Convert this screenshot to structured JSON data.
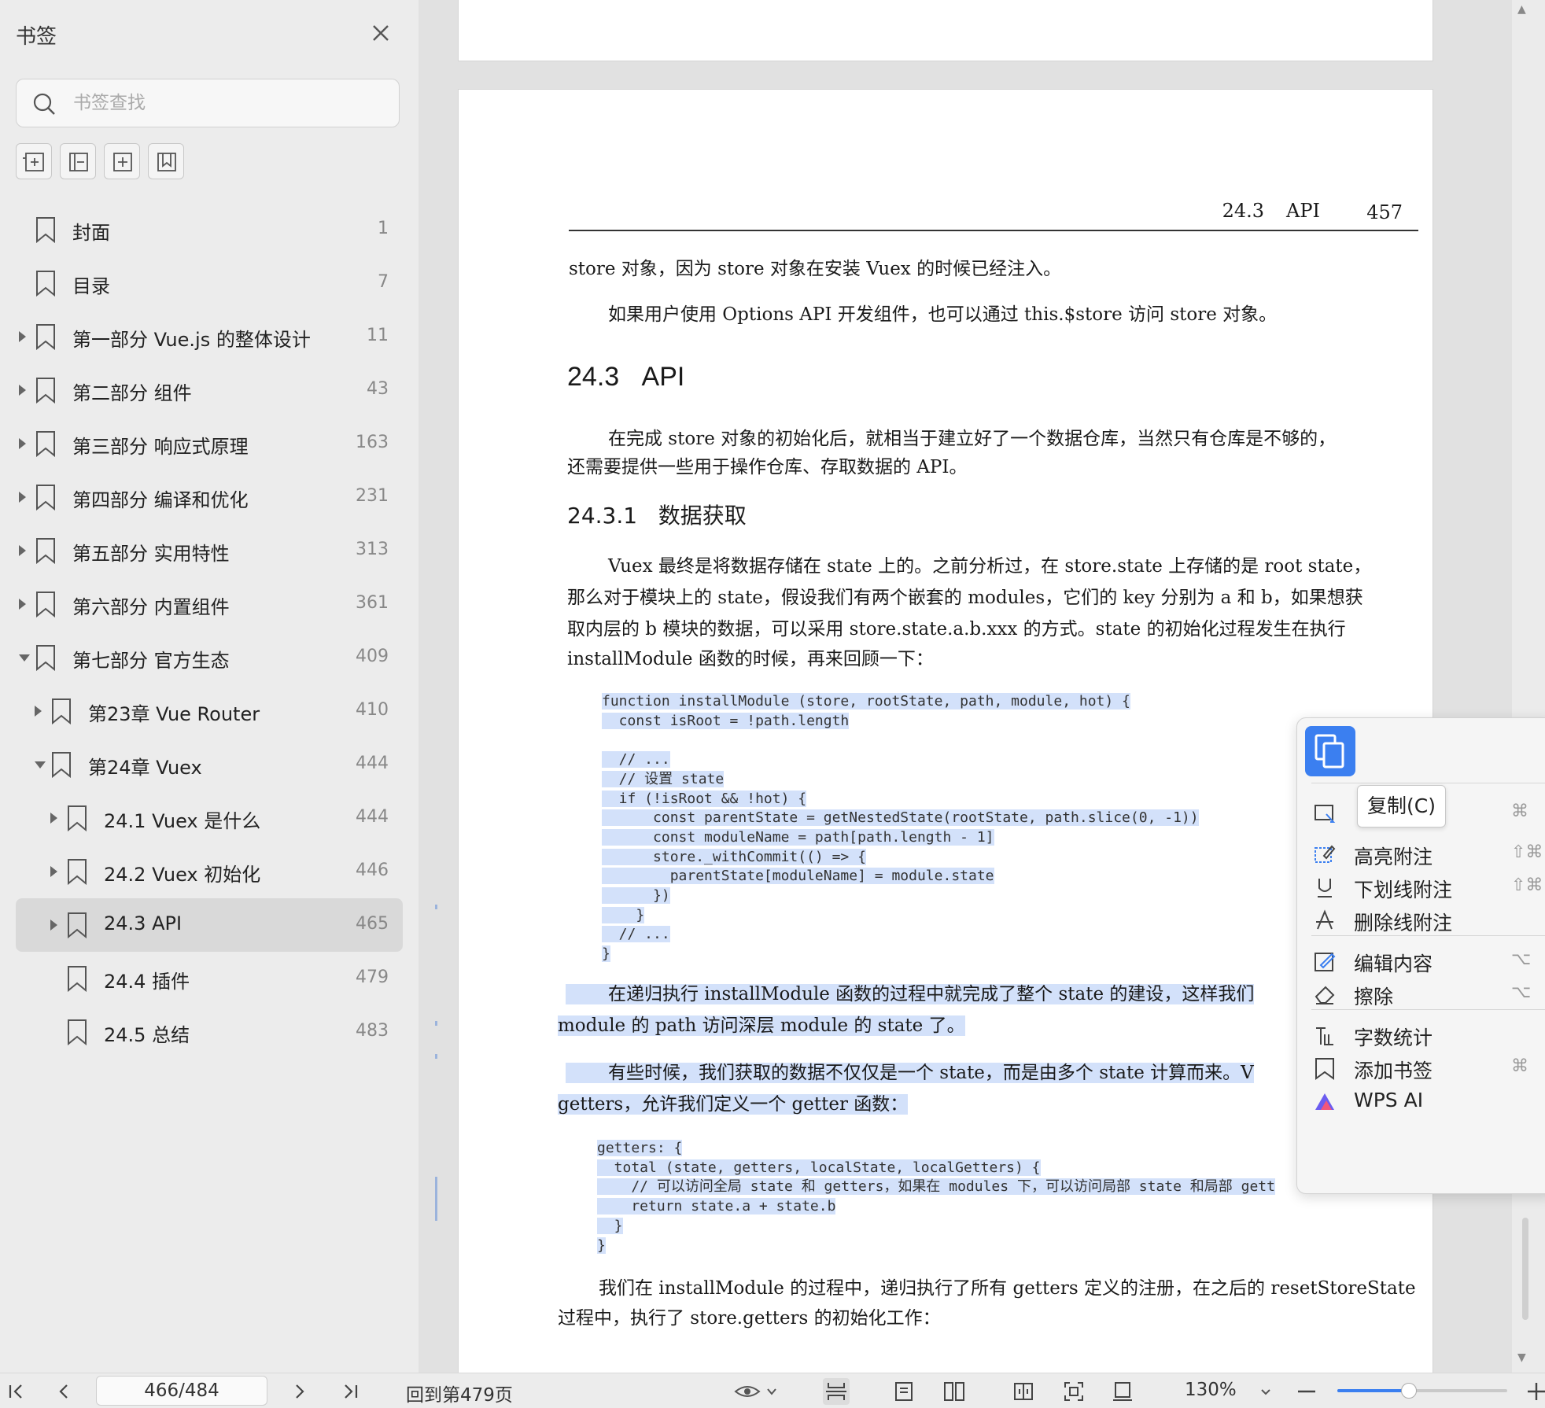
{
  "sidebar": {
    "title": "书签",
    "search_placeholder": "书签查找",
    "tools": [
      "expand-all-icon",
      "collapse-all-icon",
      "add-bookmark-icon",
      "bookmark-icon"
    ],
    "items": [
      {
        "label": "封面",
        "page": "1",
        "level": 0,
        "arrow": "none"
      },
      {
        "label": "目录",
        "page": "7",
        "level": 0,
        "arrow": "none"
      },
      {
        "label": "第一部分 Vue.js 的整体设计",
        "page": "11",
        "level": 0,
        "arrow": "collapsed"
      },
      {
        "label": "第二部分 组件",
        "page": "43",
        "level": 0,
        "arrow": "collapsed"
      },
      {
        "label": "第三部分 响应式原理",
        "page": "163",
        "level": 0,
        "arrow": "collapsed"
      },
      {
        "label": "第四部分 编译和优化",
        "page": "231",
        "level": 0,
        "arrow": "collapsed"
      },
      {
        "label": "第五部分 实用特性",
        "page": "313",
        "level": 0,
        "arrow": "collapsed"
      },
      {
        "label": "第六部分 内置组件",
        "page": "361",
        "level": 0,
        "arrow": "collapsed"
      },
      {
        "label": "第七部分 官方生态",
        "page": "409",
        "level": 0,
        "arrow": "expanded"
      },
      {
        "label": "第23章 Vue Router",
        "page": "410",
        "level": 1,
        "arrow": "collapsed"
      },
      {
        "label": "第24章 Vuex",
        "page": "444",
        "level": 1,
        "arrow": "expanded"
      },
      {
        "label": "24.1 Vuex 是什么",
        "page": "444",
        "level": 2,
        "arrow": "collapsed"
      },
      {
        "label": "24.2 Vuex 初始化",
        "page": "446",
        "level": 2,
        "arrow": "collapsed"
      },
      {
        "label": "24.3 API",
        "page": "465",
        "level": 2,
        "arrow": "collapsed",
        "selected": true
      },
      {
        "label": "24.4 插件",
        "page": "479",
        "level": 2,
        "arrow": "none"
      },
      {
        "label": "24.5 总结",
        "page": "483",
        "level": 2,
        "arrow": "none"
      }
    ]
  },
  "document": {
    "running_head": {
      "section": "24.3",
      "title": "API",
      "page": "457"
    },
    "p1": "store 对象，因为 store 对象在安装 Vuex 的时候已经注入。",
    "p2": "如果用户使用 Options API 开发组件，也可以通过 this.$store 访问 store 对象。",
    "h_section_num": "24.3",
    "h_section_title": "API",
    "p3_line1": "在完成 store 对象的初始化后，就相当于建立好了一个数据仓库，当然只有仓库是不够的，",
    "p3_line2": "还需要提供一些用于操作仓库、存取数据的 API。",
    "h_sub_num": "24.3.1",
    "h_sub_title": "数据获取",
    "p4_line1": "Vuex 最终是将数据存储在 state 上的。之前分析过，在 store.state 上存储的是 root state，",
    "p4_line2": "那么对于模块上的 state，假设我们有两个嵌套的 modules，它们的 key 分别为 a 和 b，如果想获",
    "p4_line3": "取内层的 b 模块的数据，可以采用 store.state.a.b.xxx 的方式。state 的初始化过程发生在执行",
    "p4_line4": "installModule 函数的时候，再来回顾一下：",
    "code1": [
      "function installModule (store, rootState, path, module, hot) {",
      "  const isRoot = !path.length",
      "",
      "  // ...",
      "  // 设置 state",
      "  if (!isRoot && !hot) {",
      "      const parentState = getNestedState(rootState, path.slice(0, -1))",
      "      const moduleName = path[path.length - 1]",
      "      store._withCommit(() => {",
      "        parentState[moduleName] = module.state",
      "      })",
      "    }",
      "  // ...",
      "}"
    ],
    "p5_line1": "在递归执行 installModule 函数的过程中就完成了整个 state 的建设，这样我们",
    "p5_line2": "module 的 path 访问深层 module 的 state 了。",
    "p6_line1": "有些时候，我们获取的数据不仅仅是一个 state，而是由多个 state 计算而来。V",
    "p6_line2": "getters，允许我们定义一个 getter 函数：",
    "code2": [
      "getters: {",
      "  total (state, getters, localState, localGetters) {",
      "    // 可以访问全局 state 和 getters，如果在 modules 下，可以访问局部 state 和局部 gett",
      "    return state.a + state.b",
      "  }",
      "}"
    ],
    "p7_line1": "我们在 installModule 的过程中，递归执行了所有 getters 定义的注册，在之后的 resetStoreState",
    "p7_line2": "过程中，执行了 store.getters 的初始化工作："
  },
  "context_menu": {
    "tooltip": "复制(C)",
    "items": [
      {
        "label": "",
        "icon": "select-icon",
        "shortcut": "⌘"
      },
      {
        "label": "高亮附注",
        "icon": "highlight-icon",
        "shortcut": "⇧⌘"
      },
      {
        "label": "下划线附注",
        "icon": "underline-icon",
        "shortcut": "⇧⌘"
      },
      {
        "label": "删除线附注",
        "icon": "strikethrough-icon",
        "shortcut": ""
      },
      {
        "label": "编辑内容",
        "icon": "edit-icon",
        "shortcut": "⌥"
      },
      {
        "label": "擦除",
        "icon": "eraser-icon",
        "shortcut": "⌥"
      },
      {
        "label": "字数统计",
        "icon": "word-count-icon",
        "shortcut": ""
      },
      {
        "label": "添加书签",
        "icon": "bookmark-icon",
        "shortcut": "⌘"
      },
      {
        "label": "WPS AI",
        "icon": "wps-ai-icon",
        "shortcut": ""
      }
    ]
  },
  "bottombar": {
    "page_indicator": "466/484",
    "back_to_page": "回到第479页",
    "zoom": "130%",
    "zoom_fraction": 0.42
  },
  "colors": {
    "accent": "#3b7ff0",
    "highlight": "#82aaf0",
    "sidebar_bg": "#ececec",
    "selected_bg": "#d9d9d9"
  }
}
